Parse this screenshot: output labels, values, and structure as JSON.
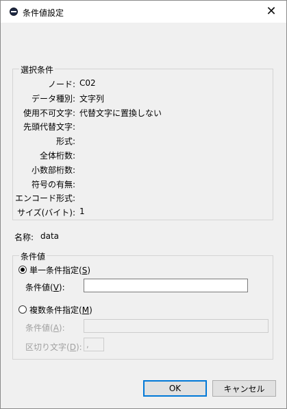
{
  "window": {
    "title": "条件値設定",
    "close_glyph": "✕"
  },
  "selection": {
    "group_title": "選択条件",
    "rows": [
      {
        "label": "ノード:",
        "value": "C02"
      },
      {
        "label": "データ種別:",
        "value": "文字列"
      },
      {
        "label": "使用不可文字:",
        "value": "代替文字に置換しない"
      },
      {
        "label": "先頭代替文字:",
        "value": ""
      },
      {
        "label": "形式:",
        "value": ""
      },
      {
        "label": "全体桁数:",
        "value": ""
      },
      {
        "label": "小数部桁数:",
        "value": ""
      },
      {
        "label": "符号の有無:",
        "value": ""
      },
      {
        "label": "エンコード形式:",
        "value": ""
      },
      {
        "label": "サイズ(バイト):",
        "value": "1"
      }
    ]
  },
  "name": {
    "label": "名称:",
    "value": "data"
  },
  "condition": {
    "group_title": "条件値",
    "single": {
      "label": "単一条件指定",
      "accel": "S",
      "selected": true,
      "value_label": "条件値",
      "value_accel": "V",
      "value": ""
    },
    "multi": {
      "label": "複数条件指定",
      "accel": "M",
      "selected": false,
      "value_label": "条件値",
      "value_accel": "A",
      "value": "",
      "delimiter_label": "区切り文字",
      "delimiter_accel": "D",
      "delimiter_value": ","
    }
  },
  "buttons": {
    "ok": "OK",
    "cancel": "キャンセル"
  }
}
